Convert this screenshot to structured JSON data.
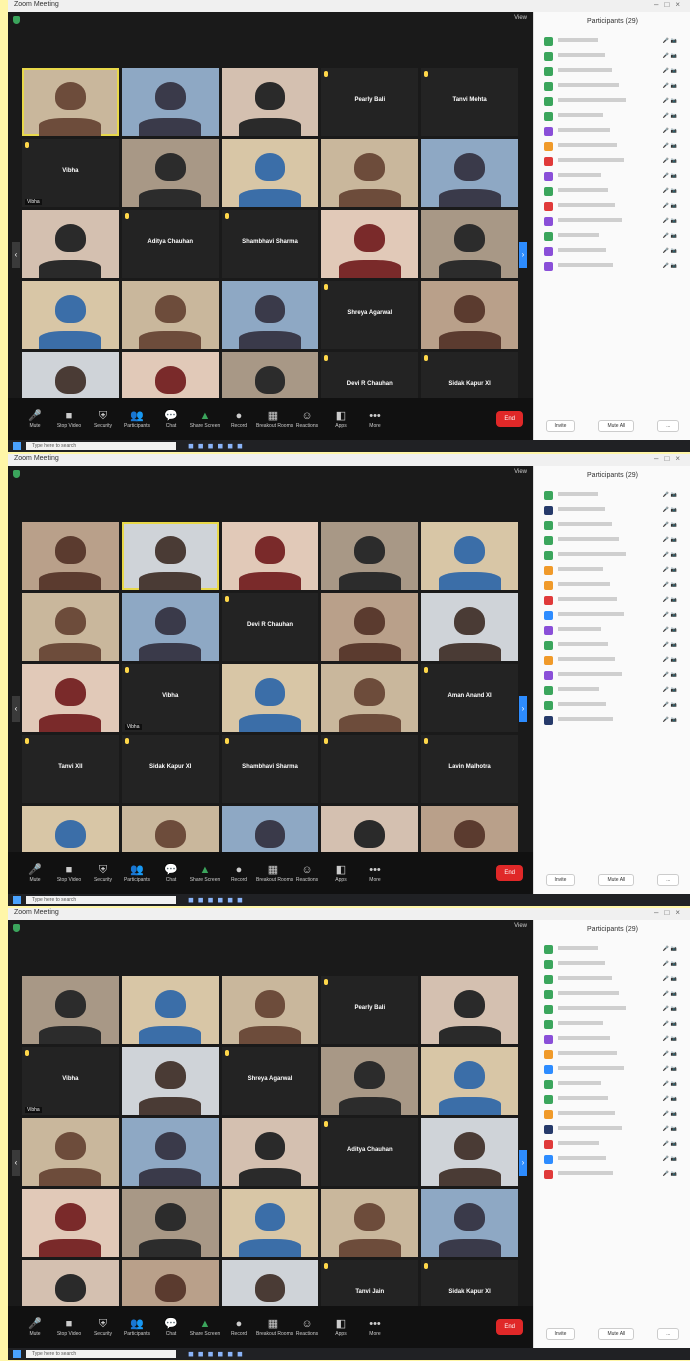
{
  "window_title": "Zoom Meeting",
  "view_label": "View",
  "participants_title": "Participants",
  "search_placeholder": "Type here to search",
  "toolbar": [
    {
      "key": "mute",
      "label": "Mute",
      "glyph": "🎤",
      "cls": ""
    },
    {
      "key": "video",
      "label": "Stop Video",
      "glyph": "■",
      "cls": ""
    },
    {
      "key": "security",
      "label": "Security",
      "glyph": "⛨",
      "cls": ""
    },
    {
      "key": "participants",
      "label": "Participants",
      "glyph": "👥",
      "cls": ""
    },
    {
      "key": "chat",
      "label": "Chat",
      "glyph": "💬",
      "cls": ""
    },
    {
      "key": "share",
      "label": "Share Screen",
      "glyph": "▲",
      "cls": "green"
    },
    {
      "key": "record",
      "label": "Record",
      "glyph": "●",
      "cls": ""
    },
    {
      "key": "rooms",
      "label": "Breakout Rooms",
      "glyph": "▦",
      "cls": ""
    },
    {
      "key": "reactions",
      "label": "Reactions",
      "glyph": "☺",
      "cls": ""
    },
    {
      "key": "apps",
      "label": "Apps",
      "glyph": "◧",
      "cls": ""
    },
    {
      "key": "more",
      "label": "More",
      "glyph": "•••",
      "cls": ""
    }
  ],
  "end_label": "End",
  "footer_buttons": [
    "Invite",
    "Mute All",
    "..."
  ],
  "screens": [
    {
      "participant_count": "Participants (29)",
      "tiles": [
        {
          "name": "",
          "center": "",
          "video": true,
          "active": true
        },
        {
          "name": "",
          "center": "",
          "video": true
        },
        {
          "name": "",
          "center": "",
          "video": true
        },
        {
          "name": "",
          "center": "Pearly Bali",
          "video": false
        },
        {
          "name": "",
          "center": "Tanvi Mehta",
          "video": false
        },
        {
          "name": "Vibha",
          "center": "Vibha",
          "video": false
        },
        {
          "name": "",
          "center": "",
          "video": true
        },
        {
          "name": "",
          "center": "",
          "video": true
        },
        {
          "name": "",
          "center": "",
          "video": true
        },
        {
          "name": "",
          "center": "",
          "video": true
        },
        {
          "name": "",
          "center": "",
          "video": true
        },
        {
          "name": "",
          "center": "Aditya Chauhan",
          "video": false
        },
        {
          "name": "",
          "center": "Shambhavi Sharma",
          "video": false
        },
        {
          "name": "",
          "center": "",
          "video": true
        },
        {
          "name": "",
          "center": "",
          "video": true
        },
        {
          "name": "",
          "center": "",
          "video": true
        },
        {
          "name": "",
          "center": "",
          "video": true
        },
        {
          "name": "",
          "center": "",
          "video": true
        },
        {
          "name": "",
          "center": "Shreya Agarwal",
          "video": false
        },
        {
          "name": "",
          "center": "",
          "video": true
        },
        {
          "name": "",
          "center": "",
          "video": true
        },
        {
          "name": "",
          "center": "",
          "video": true
        },
        {
          "name": "",
          "center": "",
          "video": true
        },
        {
          "name": "",
          "center": "Devi R Chauhan",
          "video": false
        },
        {
          "name": "",
          "center": "Sidak Kapur XI",
          "video": false
        }
      ],
      "participants": [
        {
          "av": "#3ba55c"
        },
        {
          "av": "#3ba55c"
        },
        {
          "av": "#3ba55c"
        },
        {
          "av": "#3ba55c"
        },
        {
          "av": "#3ba55c"
        },
        {
          "av": "#3ba55c"
        },
        {
          "av": "#8a4fd8"
        },
        {
          "av": "#f09a2a"
        },
        {
          "av": "#e03a3a"
        },
        {
          "av": "#8a4fd8"
        },
        {
          "av": "#3ba55c"
        },
        {
          "av": "#e03a3a"
        },
        {
          "av": "#8a4fd8"
        },
        {
          "av": "#3ba55c"
        },
        {
          "av": "#8a4fd8"
        },
        {
          "av": "#8a4fd8"
        }
      ]
    },
    {
      "participant_count": "Participants (29)",
      "tiles": [
        {
          "name": "",
          "center": "",
          "video": true
        },
        {
          "name": "",
          "center": "",
          "video": true,
          "active": true
        },
        {
          "name": "",
          "center": "",
          "video": true
        },
        {
          "name": "",
          "center": "",
          "video": true
        },
        {
          "name": "",
          "center": "",
          "video": true
        },
        {
          "name": "",
          "center": "",
          "video": true
        },
        {
          "name": "",
          "center": "",
          "video": true
        },
        {
          "name": "",
          "center": "Devi R Chauhan",
          "video": false
        },
        {
          "name": "",
          "center": "",
          "video": true
        },
        {
          "name": "",
          "center": "",
          "video": true
        },
        {
          "name": "",
          "center": "",
          "video": true
        },
        {
          "name": "Vibha",
          "center": "Vibha",
          "video": false
        },
        {
          "name": "",
          "center": "",
          "video": true
        },
        {
          "name": "",
          "center": "",
          "video": true
        },
        {
          "name": "",
          "center": "Aman Anand XI",
          "video": false
        },
        {
          "name": "",
          "center": "Tanvi XII",
          "video": false
        },
        {
          "name": "",
          "center": "Sidak Kapur XI",
          "video": false
        },
        {
          "name": "",
          "center": "Shambhavi Sharma",
          "video": false
        },
        {
          "name": "",
          "center": "",
          "video": false
        },
        {
          "name": "",
          "center": "Lavin Malhotra",
          "video": false
        },
        {
          "name": "",
          "center": "",
          "video": true
        },
        {
          "name": "",
          "center": "",
          "video": true
        },
        {
          "name": "",
          "center": "",
          "video": true
        },
        {
          "name": "",
          "center": "",
          "video": true
        },
        {
          "name": "",
          "center": "",
          "video": true
        }
      ],
      "participants": [
        {
          "av": "#3ba55c"
        },
        {
          "av": "#263a6a"
        },
        {
          "av": "#3ba55c"
        },
        {
          "av": "#3ba55c"
        },
        {
          "av": "#3ba55c"
        },
        {
          "av": "#f09a2a"
        },
        {
          "av": "#f09a2a"
        },
        {
          "av": "#e03a3a"
        },
        {
          "av": "#2d8cff"
        },
        {
          "av": "#8a4fd8"
        },
        {
          "av": "#3ba55c"
        },
        {
          "av": "#f09a2a"
        },
        {
          "av": "#8a4fd8"
        },
        {
          "av": "#3ba55c"
        },
        {
          "av": "#3ba55c"
        },
        {
          "av": "#263a6a"
        }
      ]
    },
    {
      "participant_count": "Participants (29)",
      "tiles": [
        {
          "name": "",
          "center": "",
          "video": true
        },
        {
          "name": "",
          "center": "",
          "video": true
        },
        {
          "name": "",
          "center": "",
          "video": true
        },
        {
          "name": "",
          "center": "Pearly Bali",
          "video": false
        },
        {
          "name": "",
          "center": "",
          "video": true
        },
        {
          "name": "Vibha",
          "center": "Vibha",
          "video": false
        },
        {
          "name": "",
          "center": "",
          "video": true
        },
        {
          "name": "",
          "center": "Shreya Agarwal",
          "video": false
        },
        {
          "name": "",
          "center": "",
          "video": true
        },
        {
          "name": "",
          "center": "",
          "video": true
        },
        {
          "name": "",
          "center": "",
          "video": true
        },
        {
          "name": "",
          "center": "",
          "video": true
        },
        {
          "name": "",
          "center": "",
          "video": true
        },
        {
          "name": "",
          "center": "Aditya Chauhan",
          "video": false
        },
        {
          "name": "",
          "center": "",
          "video": true
        },
        {
          "name": "",
          "center": "",
          "video": true
        },
        {
          "name": "",
          "center": "",
          "video": true
        },
        {
          "name": "",
          "center": "",
          "video": true
        },
        {
          "name": "",
          "center": "",
          "video": true
        },
        {
          "name": "",
          "center": "",
          "video": true
        },
        {
          "name": "",
          "center": "",
          "video": true
        },
        {
          "name": "",
          "center": "",
          "video": true
        },
        {
          "name": "",
          "center": "",
          "video": true
        },
        {
          "name": "",
          "center": "Tanvi Jain",
          "video": false
        },
        {
          "name": "",
          "center": "Sidak Kapur XI",
          "video": false
        }
      ],
      "participants": [
        {
          "av": "#3ba55c"
        },
        {
          "av": "#3ba55c"
        },
        {
          "av": "#3ba55c"
        },
        {
          "av": "#3ba55c"
        },
        {
          "av": "#3ba55c"
        },
        {
          "av": "#3ba55c"
        },
        {
          "av": "#8a4fd8"
        },
        {
          "av": "#f09a2a"
        },
        {
          "av": "#2d8cff"
        },
        {
          "av": "#3ba55c"
        },
        {
          "av": "#3ba55c"
        },
        {
          "av": "#f09a2a"
        },
        {
          "av": "#263a6a"
        },
        {
          "av": "#e03a3a"
        },
        {
          "av": "#2d8cff"
        },
        {
          "av": "#e03a3a"
        }
      ]
    }
  ],
  "colors": {
    "active_speaker": "#e8d84a",
    "end": "#e02828",
    "accent": "#2d8cff"
  }
}
